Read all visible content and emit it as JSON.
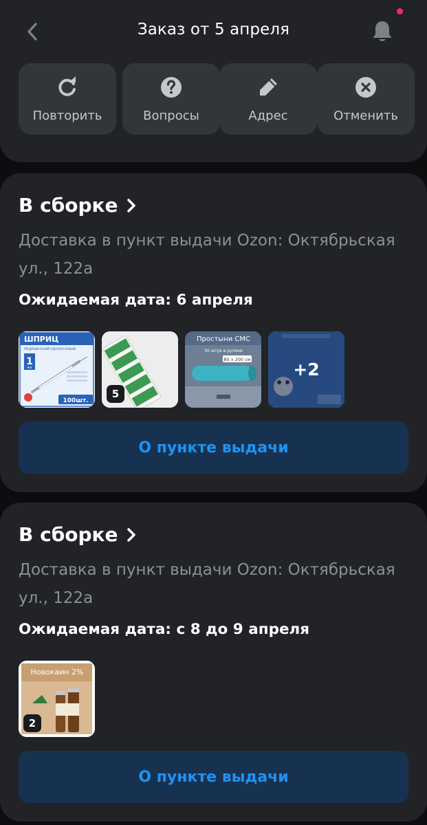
{
  "header": {
    "title": "Заказ от 5 апреля",
    "back_icon": "chevron-left-icon",
    "bell_icon": "bell-icon",
    "notification_dot_color": "#ee2b66"
  },
  "actions": [
    {
      "label": "Повторить",
      "icon": "repeat-icon"
    },
    {
      "label": "Вопросы",
      "icon": "question-icon"
    },
    {
      "label": "Адрес",
      "icon": "pencil-icon"
    },
    {
      "label": "Отменить",
      "icon": "cancel-icon"
    }
  ],
  "shipments": [
    {
      "status": "В сборке",
      "delivery": "Доставка в пункт выдачи Ozon: Октябрьская ул., 122а",
      "eta": "Ожидаемая дата: 6 апреля",
      "items": [
        {
          "name": "syringe-box",
          "label_top": "ШПРИЦ",
          "label_sub": "МЕДИЦИНСКИЙ ОДНОРАЗОВЫЙ",
          "volume": "1",
          "unit": "мл",
          "count_label": "100шт."
        },
        {
          "name": "green-packets",
          "quantity": "5"
        },
        {
          "name": "sheets-roll",
          "label_top": "Простыни СМС",
          "label_sub": "50 штук в рулоне",
          "size": "80 x 200 см"
        },
        {
          "name": "pet-pads",
          "more": "+2"
        }
      ],
      "button": "О пункте выдачи"
    },
    {
      "status": "В сборке",
      "delivery": "Доставка в пункт выдачи Ozon: Октябрьская ул., 122а",
      "eta": "Ожидаемая дата: с 8 до 9 апреля",
      "items": [
        {
          "name": "novocaine-box",
          "label_top": "Новокаин 2%",
          "quantity": "2"
        }
      ],
      "button": "О пункте выдачи"
    }
  ],
  "colors": {
    "background": "#0c0d0f",
    "card": "#212327",
    "action_tile": "#32353a",
    "accent_blue": "#1d93f5",
    "button_bg": "#173250"
  }
}
